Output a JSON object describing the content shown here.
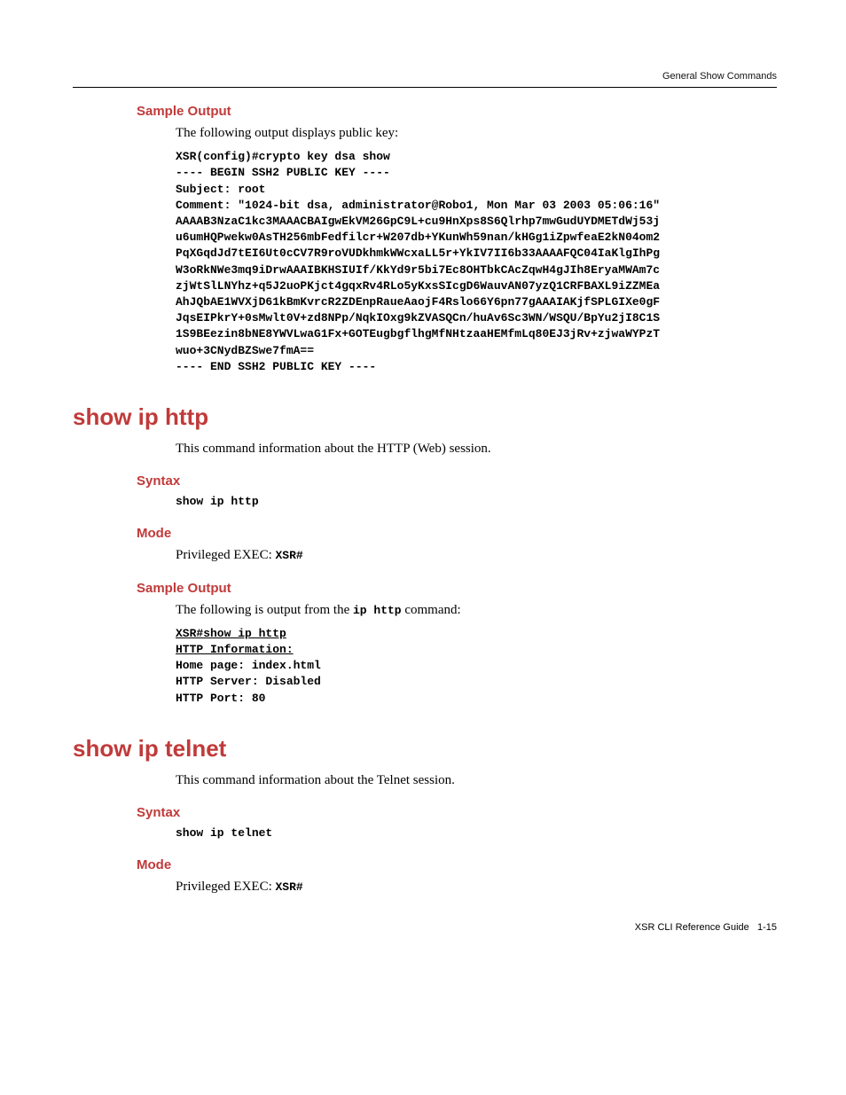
{
  "header": {
    "running_title": "General Show Commands"
  },
  "section1": {
    "label_sample": "Sample Output",
    "intro": "The following output displays public key:",
    "code": "XSR(config)#crypto key dsa show\n---- BEGIN SSH2 PUBLIC KEY ----\nSubject: root\nComment: \"1024-bit dsa, administrator@Robo1, Mon Mar 03 2003 05:06:16\"\nAAAAB3NzaC1kc3MAAACBAIgwEkVM26GpC9L+cu9HnXps8S6Qlrhp7mwGudUYDMETdWj53j\nu6umHQPwekw0AsTH256mbFedfilcr+W207db+YKunWh59nan/kHGg1iZpwfeaE2kN04om2\nPqXGqdJd7tEI6Ut0cCV7R9roVUDkhmkWWcxaLL5r+YkIV7II6b33AAAAFQC04IaKlgIhPg\nW3oRkNWe3mq9iDrwAAAIBKHSIUIf/KkYd9r5bi7Ec8OHTbkCAcZqwH4gJIh8EryaMWAm7c\nzjWtSlLNYhz+q5J2uoPKjct4gqxRv4RLo5yKxsSIcgD6WauvAN07yzQ1CRFBAXL9iZZMEa\nAhJQbAE1WVXjD61kBmKvrcR2ZDEnpRaueAaojF4Rslo66Y6pn77gAAAIAKjfSPLGIXe0gF\nJqsEIPkrY+0sMwlt0V+zd8NPp/NqkIOxg9kZVASQCn/huAv6Sc3WN/WSQU/BpYu2jI8C1S\n1S9BEezin8bNE8YWVLwaG1Fx+GOTEugbgflhgMfNHtzaaHEMfmLq80EJ3jRv+zjwaWYPzT\nwuo+3CNydBZSwe7fmA==\n---- END SSH2 PUBLIC KEY ----"
  },
  "section2": {
    "title": "show ip http",
    "desc": "This command information about the HTTP (Web) session.",
    "label_syntax": "Syntax",
    "syntax_code": "show ip http",
    "label_mode": "Mode",
    "mode_prefix": "Privileged EXEC: ",
    "mode_code": "XSR#",
    "label_sample": "Sample Output",
    "sample_prefix": "The following is output from the ",
    "sample_code_inline": "ip http",
    "sample_suffix": " command:",
    "sample_code_line1": "XSR#show ip http",
    "sample_code_line2": "HTTP Information:",
    "sample_code_rest": "Home page: index.html\nHTTP Server: Disabled\nHTTP Port: 80"
  },
  "section3": {
    "title": "show ip telnet",
    "desc": "This command information about the Telnet session.",
    "label_syntax": "Syntax",
    "syntax_code": "show ip telnet",
    "label_mode": "Mode",
    "mode_prefix": "Privileged EXEC: ",
    "mode_code": "XSR#"
  },
  "footer": {
    "guide": "XSR CLI Reference Guide",
    "page": "1-15"
  }
}
